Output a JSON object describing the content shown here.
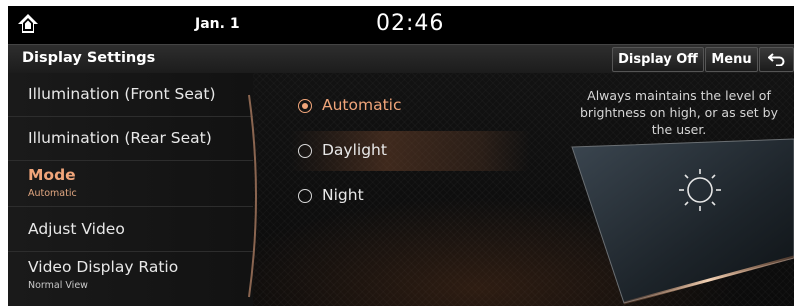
{
  "status_bar": {
    "date": "Jan. 1",
    "time": "02:46",
    "home_icon": "home-icon"
  },
  "title_bar": {
    "title": "Display Settings",
    "display_off_label": "Display Off",
    "menu_label": "Menu",
    "back_icon": "back-arrow-icon"
  },
  "sidebar": {
    "items": [
      {
        "label": "Illumination (Front Seat)",
        "sub": ""
      },
      {
        "label": "Illumination (Rear Seat)",
        "sub": ""
      },
      {
        "label": "Mode",
        "sub": "Automatic",
        "active": true
      },
      {
        "label": "Adjust Video",
        "sub": ""
      },
      {
        "label": "Video Display Ratio",
        "sub": "Normal View"
      }
    ]
  },
  "mode_options": {
    "items": [
      {
        "label": "Automatic",
        "selected": true
      },
      {
        "label": "Daylight",
        "selected": false
      },
      {
        "label": "Night",
        "selected": false
      }
    ]
  },
  "description": "Always maintains the level of brightness on high, or as set by the user.",
  "illustration_icon": "sun-display-icon",
  "colors": {
    "accent": "#f0a57a",
    "background": "#050505",
    "text": "#e8e8e8"
  }
}
